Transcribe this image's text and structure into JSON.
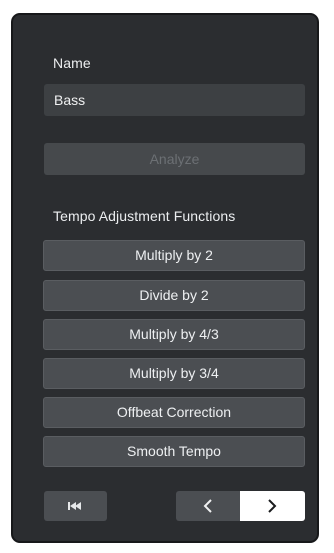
{
  "name_section": {
    "label": "Name",
    "value": "Bass"
  },
  "analyze_button": {
    "label": "Analyze",
    "enabled": false
  },
  "tempo_section": {
    "label": "Tempo Adjustment Functions",
    "buttons": [
      "Multiply by 2",
      "Divide by 2",
      "Multiply by 4/3",
      "Multiply by 3/4",
      "Offbeat Correction",
      "Smooth Tempo"
    ]
  },
  "navigation": {
    "go_to_start_icon": "skip-to-start-icon",
    "previous_icon": "chevron-left-icon",
    "next_icon": "chevron-right-icon",
    "active": "next"
  },
  "colors": {
    "panel_background": "#2b2d30",
    "button_background": "#4b4e52",
    "active_button": "#ffffff",
    "text": "#eceef0",
    "disabled_text": "#6c7074"
  }
}
